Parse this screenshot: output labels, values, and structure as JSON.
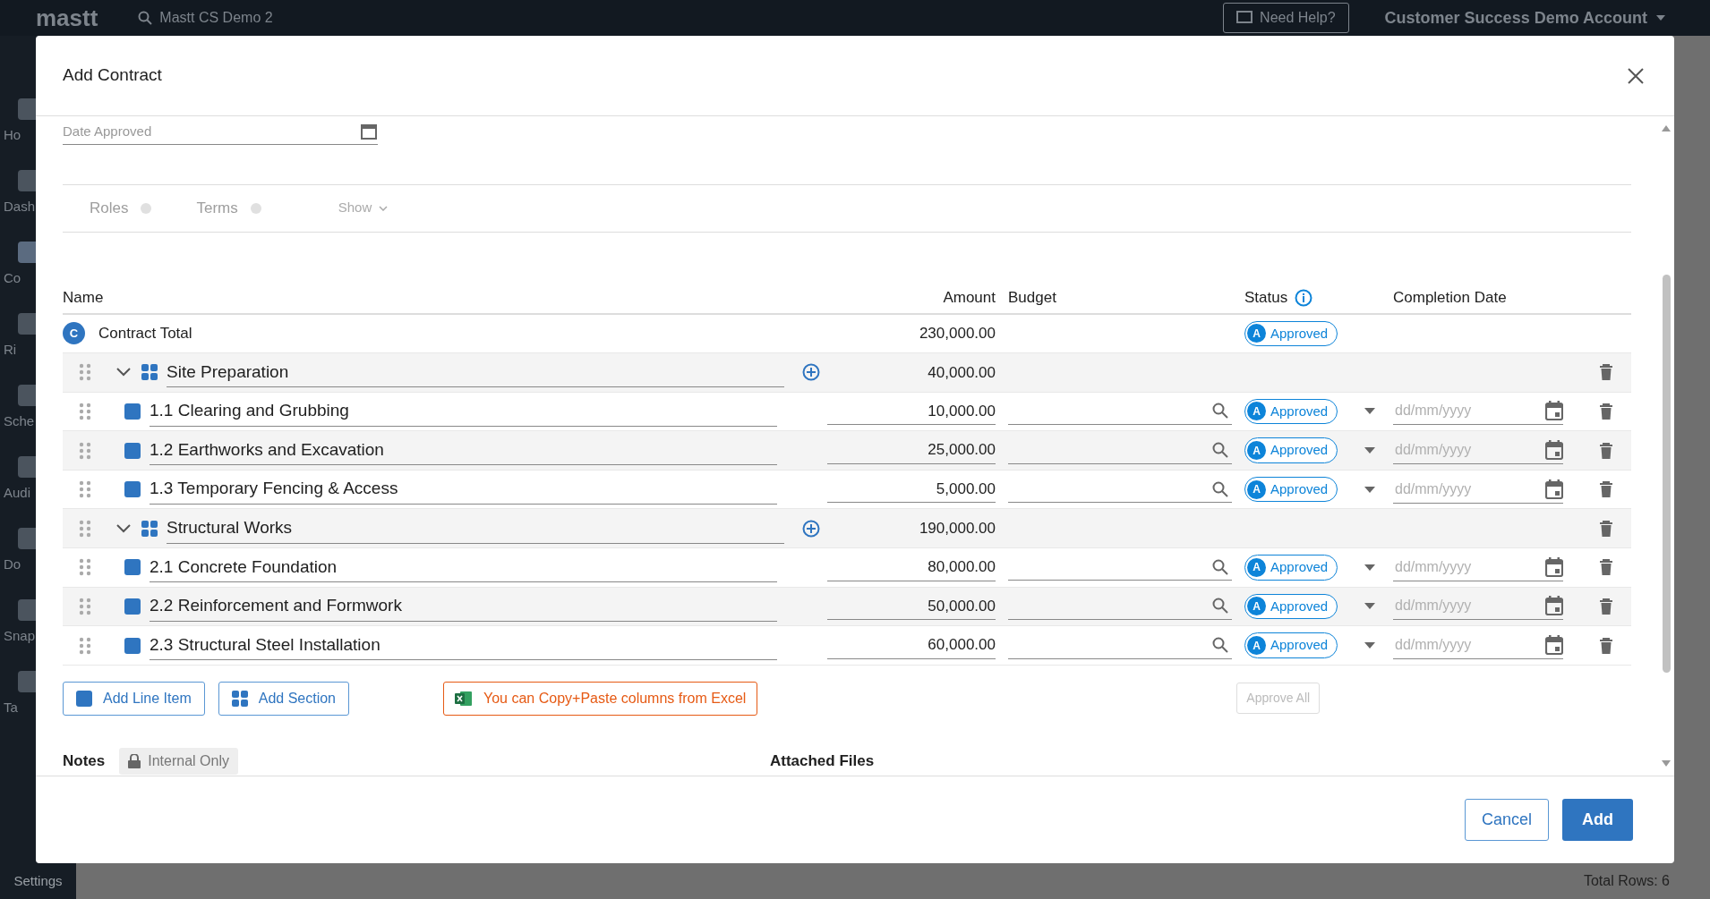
{
  "app": {
    "logo": "mastt",
    "project": "Mastt CS Demo 2",
    "help": "Need Help?",
    "account": "Customer Success Demo Account",
    "sidebar": [
      {
        "label": "Ho",
        "selected": false
      },
      {
        "label": "Dash",
        "selected": false
      },
      {
        "label": "Co",
        "selected": true
      },
      {
        "label": "Ri",
        "selected": false
      },
      {
        "label": "Sche",
        "selected": false
      },
      {
        "label": "Audi",
        "selected": false
      },
      {
        "label": "Do",
        "selected": false
      },
      {
        "label": "Snap",
        "selected": false
      },
      {
        "label": "Ta",
        "selected": false
      }
    ],
    "settings": "Settings",
    "total_rows": "Total Rows: 6"
  },
  "modal": {
    "title": "Add Contract",
    "date_label": "Date Approved",
    "tabs": [
      {
        "label": "Roles"
      },
      {
        "label": "Terms"
      }
    ],
    "show": "Show",
    "table": {
      "columns": [
        "Name",
        "Amount",
        "Budget",
        "Status",
        "Completion Date"
      ],
      "total": {
        "badge": "C",
        "name": "Contract Total",
        "amount": "230,000.00",
        "status_badge": "A",
        "status": "Approved"
      },
      "sections": [
        {
          "name": "Site Preparation",
          "amount": "40,000.00",
          "expanded": true,
          "items": [
            {
              "name": "1.1 Clearing and Grubbing",
              "amount": "10,000.00",
              "status_badge": "A",
              "status": "Approved",
              "date_placeholder": "dd/mm/yyyy"
            },
            {
              "name": "1.2 Earthworks and Excavation",
              "amount": "25,000.00",
              "status_badge": "A",
              "status": "Approved",
              "date_placeholder": "dd/mm/yyyy"
            },
            {
              "name": "1.3 Temporary Fencing & Access",
              "amount": "5,000.00",
              "status_badge": "A",
              "status": "Approved",
              "date_placeholder": "dd/mm/yyyy"
            }
          ]
        },
        {
          "name": "Structural Works",
          "amount": "190,000.00",
          "expanded": true,
          "items": [
            {
              "name": "2.1 Concrete Foundation",
              "amount": "80,000.00",
              "status_badge": "A",
              "status": "Approved",
              "date_placeholder": "dd/mm/yyyy"
            },
            {
              "name": "2.2 Reinforcement and Formwork",
              "amount": "50,000.00",
              "status_badge": "A",
              "status": "Approved",
              "date_placeholder": "dd/mm/yyyy"
            },
            {
              "name": "2.3 Structural Steel Installation",
              "amount": "60,000.00",
              "status_badge": "A",
              "status": "Approved",
              "date_placeholder": "dd/mm/yyyy"
            }
          ]
        }
      ]
    },
    "add_line_item": "Add Line Item",
    "add_section": "Add Section",
    "excel_hint": "You can Copy+Paste columns from Excel",
    "approve_all": {
      "label": "Approve All",
      "disabled": true
    },
    "notes": "Notes",
    "internal": "Internal Only",
    "attached": "Attached Files",
    "cancel": "Cancel",
    "add": "Add"
  }
}
